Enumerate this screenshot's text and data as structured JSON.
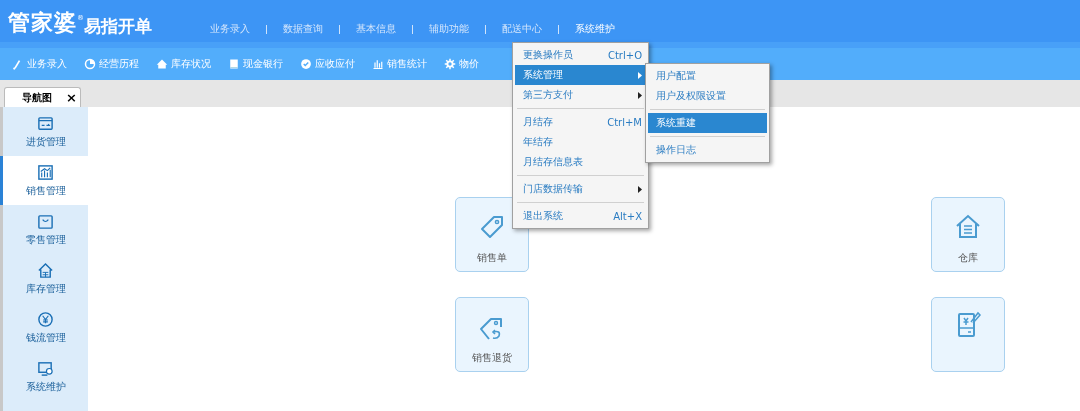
{
  "header": {
    "brand": "管家婆",
    "trademark": "®",
    "product": "易指开单",
    "nav": [
      {
        "label": "业务录入",
        "selected": false
      },
      {
        "label": "数据查询",
        "selected": false
      },
      {
        "label": "基本信息",
        "selected": false
      },
      {
        "label": "辅助功能",
        "selected": false
      },
      {
        "label": "配送中心",
        "selected": false
      },
      {
        "label": "系统维护",
        "selected": true
      }
    ]
  },
  "toolbar": [
    "业务录入",
    "经营历程",
    "库存状况",
    "现金银行",
    "应收应付",
    "销售统计",
    "物价"
  ],
  "tab": {
    "label": "导航图",
    "close": "×"
  },
  "sidebar": [
    {
      "label": "进货管理",
      "selected": false
    },
    {
      "label": "销售管理",
      "selected": true
    },
    {
      "label": "零售管理",
      "selected": false
    },
    {
      "label": "库存管理",
      "selected": false
    },
    {
      "label": "钱流管理",
      "selected": false
    },
    {
      "label": "系统维护",
      "selected": false
    }
  ],
  "tiles": [
    {
      "kind": "labeled",
      "label": "销售单"
    },
    {
      "kind": "labeled",
      "label": "仓库"
    },
    {
      "kind": "labeled",
      "label": "销售退货"
    },
    {
      "kind": "icon_only"
    }
  ],
  "menu": [
    {
      "kind": "item",
      "label": "更换操作员",
      "shortcut": "Ctrl+O",
      "selected": false
    },
    {
      "kind": "item",
      "label": "系统管理",
      "submenu": true,
      "selected": true
    },
    {
      "kind": "item",
      "label": "第三方支付",
      "submenu": true,
      "selected": false
    },
    {
      "kind": "separator"
    },
    {
      "kind": "item",
      "label": "月结存",
      "shortcut": "Ctrl+M",
      "selected": false
    },
    {
      "kind": "item",
      "label": "年结存",
      "selected": false
    },
    {
      "kind": "item",
      "label": "月结存信息表",
      "selected": false
    },
    {
      "kind": "separator"
    },
    {
      "kind": "item",
      "label": "门店数据传输",
      "submenu": true,
      "selected": false
    },
    {
      "kind": "separator"
    },
    {
      "kind": "item",
      "label": "退出系统",
      "shortcut": "Alt+X",
      "selected": false
    }
  ],
  "submenu": [
    {
      "kind": "item",
      "label": "用户配置",
      "selected": false
    },
    {
      "kind": "item",
      "label": "用户及权限设置",
      "selected": false
    },
    {
      "kind": "separator"
    },
    {
      "kind": "item",
      "label": "系统重建",
      "selected": true
    },
    {
      "kind": "separator"
    },
    {
      "kind": "item",
      "label": "操作日志",
      "selected": false
    }
  ]
}
